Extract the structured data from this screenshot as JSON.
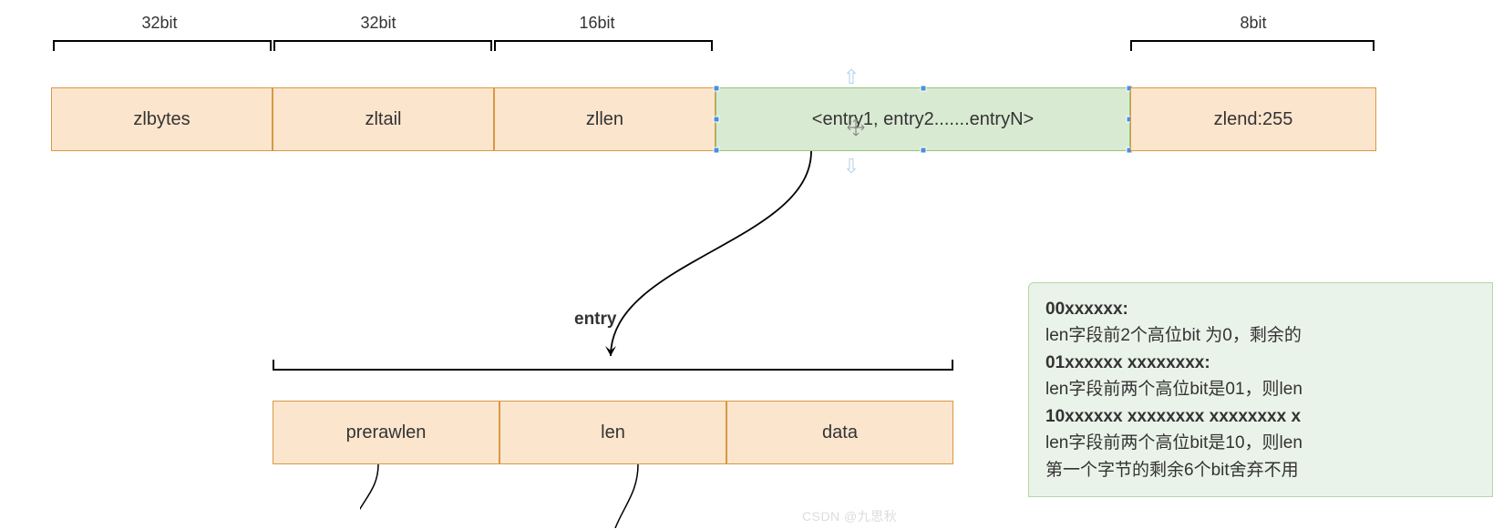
{
  "bits": {
    "zlbytes": "32bit",
    "zltail": "32bit",
    "zllen": "16bit",
    "zlend": "8bit"
  },
  "header": {
    "zlbytes": "zlbytes",
    "zltail": "zltail",
    "zllen": "zllen",
    "entries": "<entry1, entry2.......entryN>",
    "zlend": "zlend:255"
  },
  "entry": {
    "label": "entry",
    "prerawlen": "prerawlen",
    "len": "len",
    "data": "data"
  },
  "sidebar": {
    "h1": "00xxxxxx:",
    "t1": "len字段前2个高位bit 为0，剩余的",
    "h2": "01xxxxxx xxxxxxxx:",
    "t2": "len字段前两个高位bit是01，则len",
    "h3": "10xxxxxx xxxxxxxx xxxxxxxx x",
    "t3": "len字段前两个高位bit是10，则len",
    "t4": "第一个字节的剩余6个bit舍弃不用"
  },
  "watermark": "CSDN @九思秋"
}
